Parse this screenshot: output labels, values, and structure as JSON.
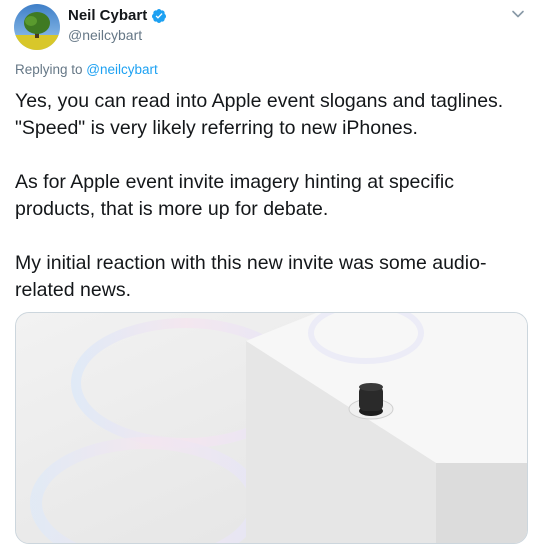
{
  "author": {
    "display_name": "Neil Cybart",
    "handle": "@neilcybart",
    "verified": true,
    "avatar_icon": "tree-avatar"
  },
  "reply": {
    "prefix": "Replying to ",
    "handle": "@neilcybart"
  },
  "tweet": {
    "text": "Yes, you can read into Apple event slogans and taglines. \"Speed\" is very likely referring to new iPhones.\n\nAs for Apple event invite imagery hinting at specific products, that is more up for debate.\n\nMy initial reaction with this new invite was some audio-related news."
  },
  "media": {
    "alt_icon": "speaker-on-white-blocks-image"
  },
  "colors": {
    "accent": "#1da1f2",
    "text": "#14171a",
    "secondary": "#657786",
    "border": "#ccd6dd"
  },
  "icons": {
    "verified": "verified-badge-icon",
    "menu": "chevron-down-icon"
  }
}
